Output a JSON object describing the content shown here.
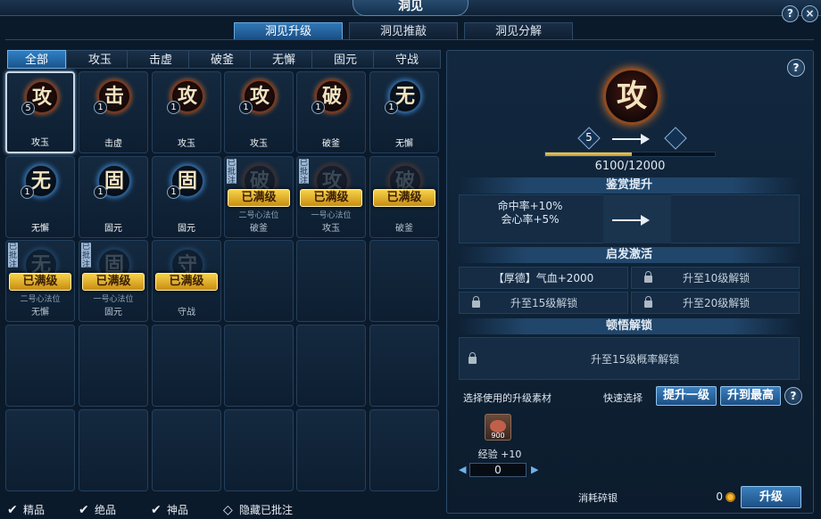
{
  "window": {
    "title": "洞见",
    "help": "?",
    "close": "×"
  },
  "main_tabs": [
    "洞见升级",
    "洞见推敲",
    "洞见分解"
  ],
  "filter_tabs": [
    "全部",
    "攻玉",
    "击虚",
    "破釜",
    "无懈",
    "固元",
    "守战"
  ],
  "cells": [
    {
      "glyph": "攻",
      "level": "5",
      "name": "攻玉",
      "selected": true,
      "maxed": false,
      "note": "",
      "pos": ""
    },
    {
      "glyph": "击",
      "level": "1",
      "name": "击虚",
      "selected": false,
      "maxed": false,
      "note": "",
      "pos": ""
    },
    {
      "glyph": "攻",
      "level": "1",
      "name": "攻玉",
      "selected": false,
      "maxed": false,
      "note": "",
      "pos": ""
    },
    {
      "glyph": "攻",
      "level": "1",
      "name": "攻玉",
      "selected": false,
      "maxed": false,
      "note": "",
      "pos": ""
    },
    {
      "glyph": "破",
      "level": "1",
      "name": "破釜",
      "selected": false,
      "maxed": false,
      "note": "",
      "pos": ""
    },
    {
      "glyph": "无",
      "level": "1",
      "name": "无懈",
      "selected": false,
      "maxed": false,
      "note": "",
      "pos": ""
    },
    {
      "glyph": "无",
      "level": "1",
      "name": "无懈",
      "selected": false,
      "maxed": false,
      "note": "",
      "pos": ""
    },
    {
      "glyph": "固",
      "level": "1",
      "name": "固元",
      "selected": false,
      "maxed": false,
      "note": "",
      "pos": ""
    },
    {
      "glyph": "固",
      "level": "1",
      "name": "固元",
      "selected": false,
      "maxed": false,
      "note": "",
      "pos": ""
    },
    {
      "glyph": "破",
      "level": "",
      "name": "破釜",
      "selected": false,
      "maxed": true,
      "note": "已批注",
      "pos": "二号心法位"
    },
    {
      "glyph": "攻",
      "level": "",
      "name": "攻玉",
      "selected": false,
      "maxed": true,
      "note": "已批注",
      "pos": "一号心法位"
    },
    {
      "glyph": "破",
      "level": "",
      "name": "破釜",
      "selected": false,
      "maxed": true,
      "note": "",
      "pos": ""
    },
    {
      "glyph": "无",
      "level": "",
      "name": "无懈",
      "selected": false,
      "maxed": true,
      "note": "已批注",
      "pos": "二号心法位"
    },
    {
      "glyph": "固",
      "level": "",
      "name": "固元",
      "selected": false,
      "maxed": true,
      "note": "已批注",
      "pos": "一号心法位"
    },
    {
      "glyph": "守",
      "level": "",
      "name": "守战",
      "selected": false,
      "maxed": true,
      "note": "",
      "pos": ""
    }
  ],
  "maxed_label": "已满级",
  "legend": [
    {
      "label": "精品",
      "type": "check"
    },
    {
      "label": "绝品",
      "type": "check"
    },
    {
      "label": "神品",
      "type": "check"
    },
    {
      "label": "隐藏已批注",
      "type": "diamond"
    }
  ],
  "detail": {
    "glyph": "攻",
    "from_level": "5",
    "to_level": "",
    "progress_text": "6100/12000",
    "progress": 0.508,
    "appreciate_title": "鉴赏提升",
    "stats": [
      "命中率+10%",
      "会心率+5%"
    ],
    "activate_title": "启发激活",
    "activate": [
      {
        "text": "【厚德】气血+2000",
        "locked": false
      },
      {
        "text": "升至10级解锁",
        "locked": true
      },
      {
        "text": "升至15级解锁",
        "locked": true
      },
      {
        "text": "升至20级解锁",
        "locked": true
      }
    ],
    "unlock_title": "顿悟解锁",
    "unlock_text": "升至15级概率解锁",
    "material_label": "选择使用的升级素材",
    "quick_label": "快速选择",
    "btn_one": "提升一级",
    "btn_max": "升到最高",
    "material_count": "900",
    "exp_label": "经验 +10",
    "qty": "0",
    "cost_label": "消耗碎银",
    "cost_value": "0",
    "upgrade_btn": "升级"
  },
  "colors": {
    "accent": "#2f7fc4",
    "gold": "#f2cc5c",
    "bg": "#0b1a2b"
  }
}
